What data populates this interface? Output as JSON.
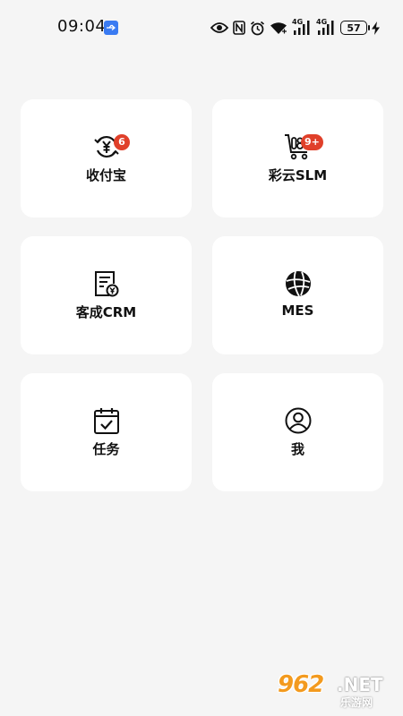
{
  "status_bar": {
    "time": "09:04",
    "network_1": "4G",
    "network_2": "4G",
    "battery": "57"
  },
  "apps": [
    {
      "label": "收付宝",
      "badge": "6",
      "icon": "yuan-refresh-icon"
    },
    {
      "label": "彩云SLM",
      "badge": "9+",
      "icon": "shopping-cart-icon"
    },
    {
      "label": "客成CRM",
      "badge": "",
      "icon": "invoice-yuan-icon"
    },
    {
      "label": "MES",
      "badge": "",
      "icon": "globe-icon"
    },
    {
      "label": "任务",
      "badge": "",
      "icon": "calendar-check-icon"
    },
    {
      "label": "我",
      "badge": "",
      "icon": "user-icon"
    }
  ],
  "watermark": {
    "main": "962",
    "net": ".NET",
    "sub": "乐游网"
  },
  "colors": {
    "background": "#f5f5f5",
    "card": "#ffffff",
    "badge": "#e0402a",
    "usb_indicator": "#3a7bf2"
  }
}
